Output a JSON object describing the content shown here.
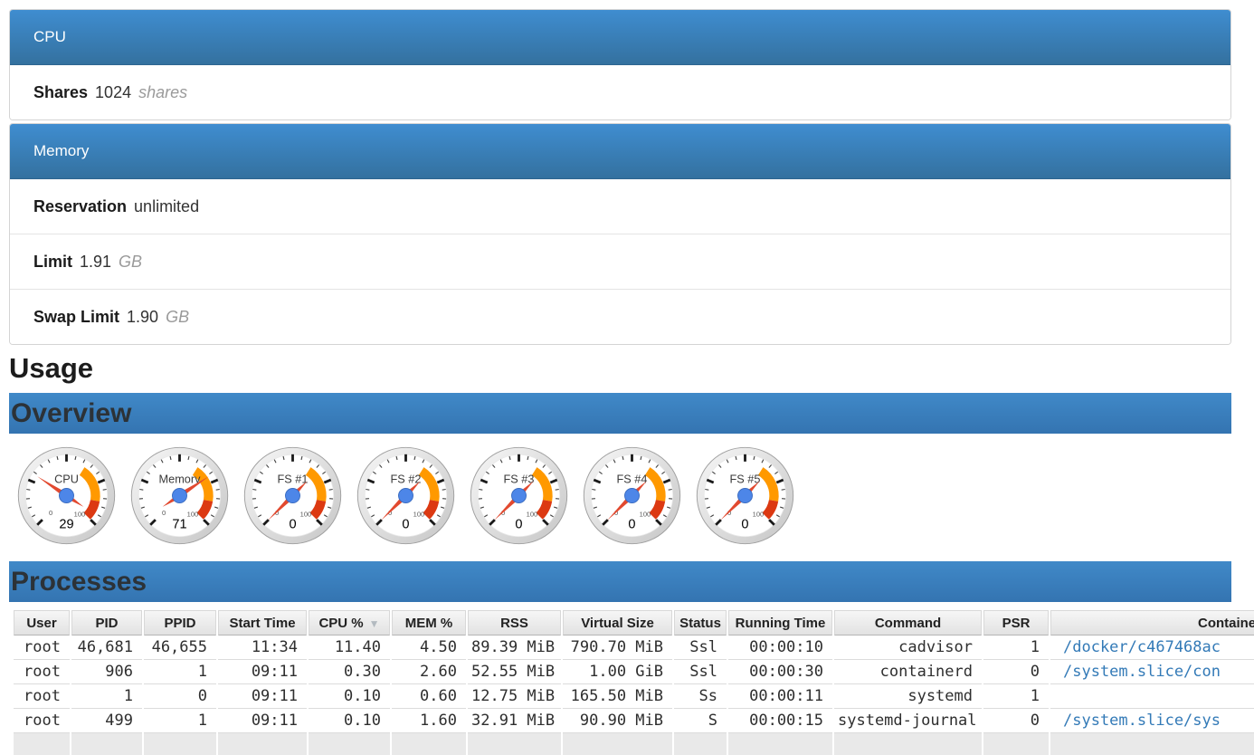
{
  "cgroup_panels": [
    {
      "title": "CPU",
      "items": [
        {
          "label": "Shares",
          "value": "1024",
          "unit": "shares"
        }
      ]
    },
    {
      "title": "Memory",
      "items": [
        {
          "label": "Reservation",
          "value": "unlimited",
          "unit": ""
        },
        {
          "label": "Limit",
          "value": "1.91",
          "unit": "GB"
        },
        {
          "label": "Swap Limit",
          "value": "1.90",
          "unit": "GB"
        }
      ]
    }
  ],
  "usage_section": {
    "heading": "Usage",
    "overview_heading": "Overview",
    "processes_heading": "Processes"
  },
  "gauges": {
    "scale": {
      "min": 0,
      "max": 100,
      "min_label": "0",
      "max_label": "100",
      "yellow_from": 62,
      "yellow_to": 87,
      "red_from": 87,
      "red_to": 100
    },
    "items": [
      {
        "label": "CPU",
        "value": 29
      },
      {
        "label": "Memory",
        "value": 71
      },
      {
        "label": "FS #1",
        "value": 0
      },
      {
        "label": "FS #2",
        "value": 0
      },
      {
        "label": "FS #3",
        "value": 0
      },
      {
        "label": "FS #4",
        "value": 0
      },
      {
        "label": "FS #5",
        "value": 0
      }
    ]
  },
  "process_table": {
    "columns": [
      "User",
      "PID",
      "PPID",
      "Start Time",
      "CPU %",
      "MEM %",
      "RSS",
      "Virtual Size",
      "Status",
      "Running Time",
      "Command",
      "PSR",
      "Container"
    ],
    "sort": {
      "column": "CPU %",
      "column_index": 4,
      "direction": "desc"
    },
    "rows": [
      [
        "root",
        "46,681",
        "46,655",
        "11:34",
        "11.40",
        "4.50",
        "89.39 MiB",
        "790.70 MiB",
        "Ssl",
        "00:00:10",
        "cadvisor",
        "1",
        "/docker/c467468ac"
      ],
      [
        "root",
        "906",
        "1",
        "09:11",
        "0.30",
        "2.60",
        "52.55 MiB",
        "1.00 GiB",
        "Ssl",
        "00:00:30",
        "containerd",
        "0",
        "/system.slice/con"
      ],
      [
        "root",
        "1",
        "0",
        "09:11",
        "0.10",
        "0.60",
        "12.75 MiB",
        "165.50 MiB",
        "Ss",
        "00:00:11",
        "systemd",
        "1",
        ""
      ],
      [
        "root",
        "499",
        "1",
        "09:11",
        "0.10",
        "1.60",
        "32.91 MiB",
        "90.90 MiB",
        "S",
        "00:00:15",
        "systemd-journal",
        "0",
        "/system.slice/sys"
      ]
    ],
    "partial_next_row": true
  },
  "colors": {
    "panel_header_blue_top": "#3f8dd0",
    "panel_header_blue_bottom": "#34719f",
    "section_bar_blue_top": "#4089c8",
    "section_bar_blue_bottom": "#3474b1",
    "gauge_yellow": "#ff9900",
    "gauge_red": "#dc3912",
    "gauge_needle": "#e2492f",
    "gauge_hub": "#4d86e8",
    "link_blue": "#337ab7",
    "sort_arrow_gray": "#b3bac0"
  }
}
